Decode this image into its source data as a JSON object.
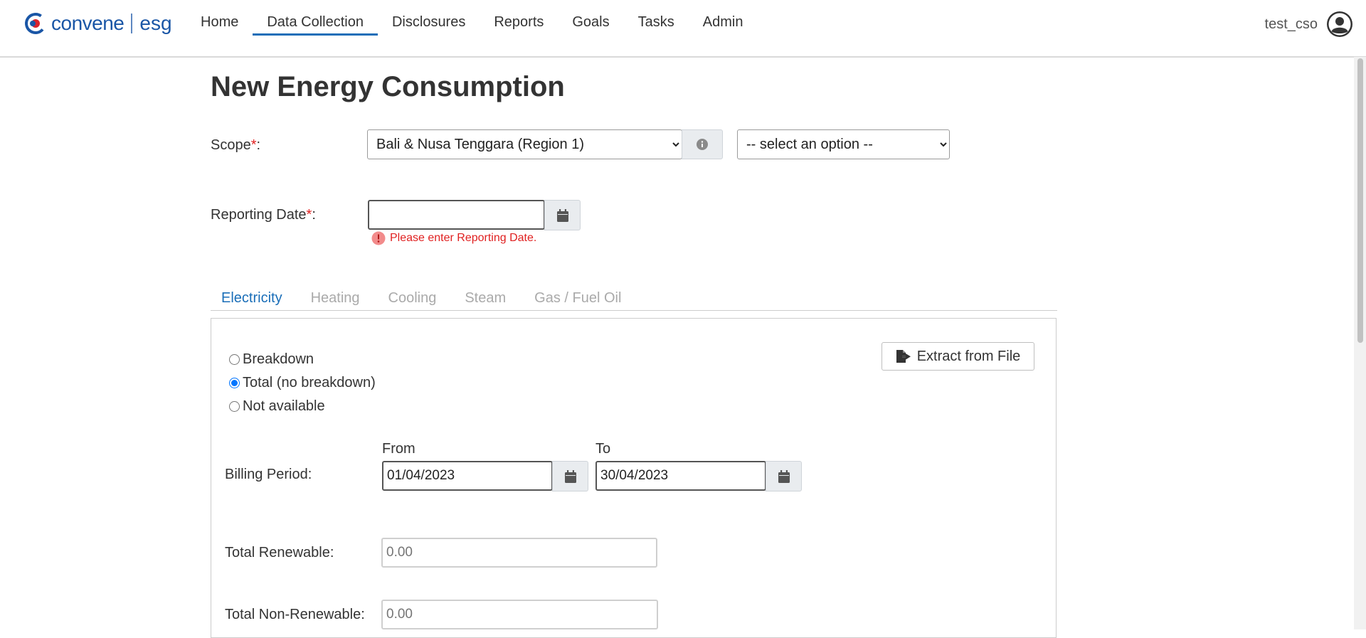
{
  "brand": {
    "name": "convene",
    "suffix": "esg",
    "accent": "#1a56a6"
  },
  "nav": [
    {
      "label": "Home",
      "active": false
    },
    {
      "label": "Data Collection",
      "active": true
    },
    {
      "label": "Disclosures",
      "active": false
    },
    {
      "label": "Reports",
      "active": false
    },
    {
      "label": "Goals",
      "active": false
    },
    {
      "label": "Tasks",
      "active": false
    },
    {
      "label": "Admin",
      "active": false
    }
  ],
  "user": {
    "name": "test_cso",
    "icon": "user-circle-icon"
  },
  "page": {
    "title": "New Energy Consumption"
  },
  "scope": {
    "label": "Scope",
    "required_mark": "*",
    "colon": ":",
    "selected": "Bali & Nusa Tenggara (Region 1)",
    "info_icon": "info-icon",
    "secondary_placeholder": "-- select an option --"
  },
  "reporting_date": {
    "label": "Reporting Date",
    "required_mark": "*",
    "colon": ":",
    "value": "",
    "error": "Please enter Reporting Date.",
    "error_color": "#e02020"
  },
  "tabs": [
    {
      "label": "Electricity",
      "active": true
    },
    {
      "label": "Heating",
      "active": false
    },
    {
      "label": "Cooling",
      "active": false
    },
    {
      "label": "Steam",
      "active": false
    },
    {
      "label": "Gas / Fuel Oil",
      "active": false
    }
  ],
  "electricity": {
    "options": [
      {
        "label": "Breakdown",
        "checked": false
      },
      {
        "label": "Total (no breakdown)",
        "checked": true
      },
      {
        "label": "Not available",
        "checked": false
      }
    ],
    "extract_button": "Extract from File",
    "billing_period": {
      "label": "Billing Period:",
      "from_label": "From",
      "to_label": "To",
      "from": "01/04/2023",
      "to": "30/04/2023"
    },
    "total_renewable": {
      "label": "Total Renewable:",
      "value": "0.00"
    },
    "total_non_renewable": {
      "label": "Total Non-Renewable:",
      "value": "0.00"
    }
  }
}
